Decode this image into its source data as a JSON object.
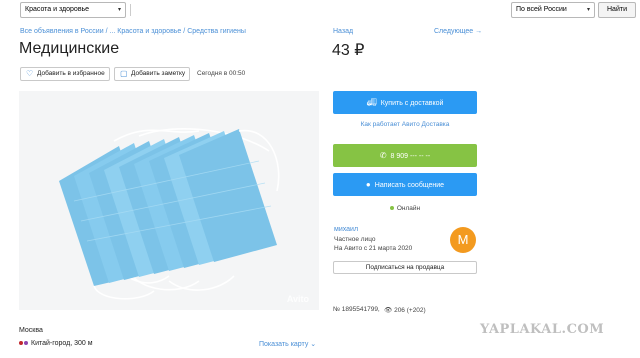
{
  "search": {
    "category": "Красота и здоровье",
    "region": "По всей России",
    "find_label": "Найти"
  },
  "breadcrumbs": [
    "Все объявления в России / ...",
    "Красота и здоровье /",
    "Средства гигиены"
  ],
  "title": "Медицинские",
  "actions": {
    "favorite_label": "Добавить в избранное",
    "note_label": "Добавить заметку",
    "date_text": "Сегодня в 00:50"
  },
  "photo": {
    "watermark": "Avito"
  },
  "location": {
    "city": "Москва",
    "metro": "Китай-город, 300 м",
    "show_map": "Показать карту ⌄"
  },
  "nav": {
    "back": "Назад",
    "next": "Следующее →"
  },
  "price": "43 ₽",
  "buttons": {
    "delivery": "Купить с доставкой",
    "how_delivery": "Как работает Авито Доставка",
    "phone": "8 909 --- -- --",
    "message": "Написать сообщение"
  },
  "status": "Онлайн",
  "seller": {
    "name": "михаил",
    "type": "Частное лицо",
    "since": "На Авито с 21 марта 2020",
    "avatar_letter": "М",
    "subscribe": "Подписаться на продавца"
  },
  "meta": {
    "ad_number": "№ 1895541799,",
    "views": "206 (+202)"
  },
  "site_watermark": "YAPLAKAL.COM",
  "colors": {
    "link": "#4a8fd6",
    "primary": "#2b9af3",
    "phone_green": "#86c344",
    "avatar": "#f39a1f"
  }
}
